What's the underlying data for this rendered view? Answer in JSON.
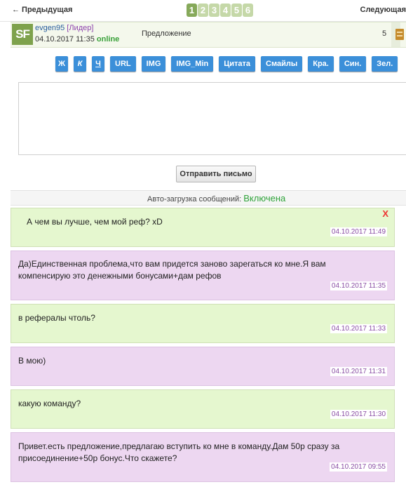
{
  "nav": {
    "prev_label": "← Предыдущая",
    "next_label": "Следующая",
    "pages": [
      "1",
      "2",
      "3",
      "4",
      "5",
      "6"
    ],
    "current_page": "1"
  },
  "thread": {
    "avatar_text": "SF",
    "username": "evgen95",
    "role": "[Лидер]",
    "date": "04.10.2017 11:35",
    "status": "online",
    "subject": "Предложение",
    "count": "5",
    "icon": "document-icon"
  },
  "toolbar": {
    "buttons": [
      "Ж",
      "К",
      "Ч",
      "URL",
      "IMG",
      "IMG_Min",
      "Цитата",
      "Смайлы",
      "Кра.",
      "Син.",
      "Зел."
    ]
  },
  "editor": {
    "value": "",
    "placeholder": ""
  },
  "send_label": "Отправить письмо",
  "autoload": {
    "label": "Авто-загрузка сообщений:",
    "value": "Включена"
  },
  "messages": [
    {
      "text": "А чем вы лучше, чем мой реф? xD",
      "time": "04.10.2017 11:49",
      "color": "green",
      "deletable": true,
      "delete_label": "X"
    },
    {
      "text": "Да)Единственная проблема,что вам придется заново зарегаться ко мне.Я вам компенсирую это денежными бонусами+дам рефов",
      "time": "04.10.2017 11:35",
      "color": "pink"
    },
    {
      "text": "в рефералы чтоль?",
      "time": "04.10.2017 11:33",
      "color": "green"
    },
    {
      "text": "В мою)",
      "time": "04.10.2017 11:31",
      "color": "pink"
    },
    {
      "text": "какую команду?",
      "time": "04.10.2017 11:30",
      "color": "green"
    },
    {
      "text": "Привет.есть предложение,предлагаю вступить ко мне в команду.Дам 50р сразу за присоединение+50р бонус.Что скажете?",
      "time": "04.10.2017 09:55",
      "color": "pink"
    }
  ],
  "colors": {
    "green_bg": "#e5f7cf",
    "pink_bg": "#edd7f1",
    "button_blue": "#3b8fd9",
    "pager_active": "#86a95a"
  }
}
